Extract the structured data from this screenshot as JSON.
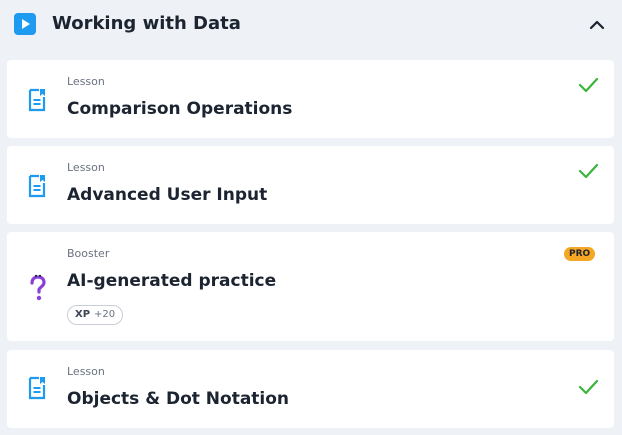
{
  "section": {
    "title": "Working with Data",
    "play_icon": "play-icon",
    "collapse_icon": "chevron-up-icon",
    "accent_color": "#1e9bf0"
  },
  "items": [
    {
      "type": "Lesson",
      "name": "Comparison Operations",
      "icon": "document-icon",
      "completed": true
    },
    {
      "type": "Lesson",
      "name": "Advanced User Input",
      "icon": "document-icon",
      "completed": true
    },
    {
      "type": "Booster",
      "name": "AI-generated practice",
      "icon": "question-mark-icon",
      "badge": "PRO",
      "xp_label": "XP",
      "xp_value": "+20",
      "completed": false
    },
    {
      "type": "Lesson",
      "name": "Objects & Dot Notation",
      "icon": "document-icon",
      "completed": true
    }
  ],
  "colors": {
    "check": "#3ab53a",
    "pro_badge": "#f5a623",
    "booster_icon": "#8b3fd9"
  }
}
